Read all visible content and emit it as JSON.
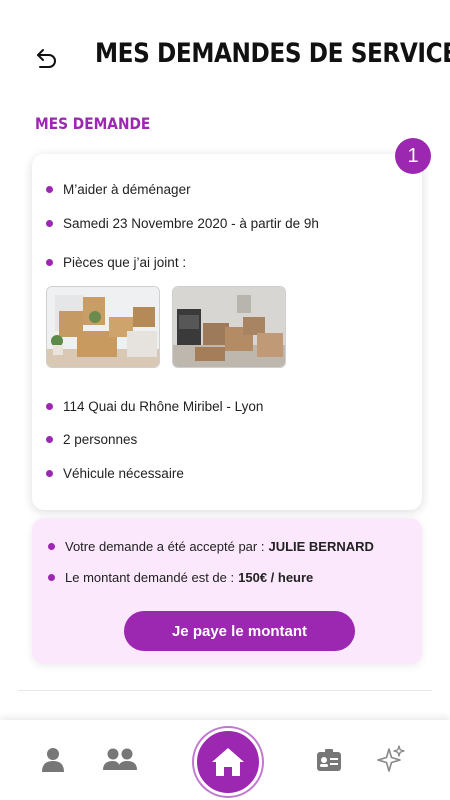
{
  "header": {
    "title": "MES DEMANDES DE SERVICE",
    "back_icon": "back-arrow-icon"
  },
  "section": {
    "title": "MES DEMANDE"
  },
  "request": {
    "count": "1",
    "service": "M’aider à déménager",
    "date": "Samedi 23 Novembre 2020 - à partir de 9h",
    "attachments_label": "Pièces que j’ai joint :",
    "address": "114 Quai du Rhône Miribel - Lyon",
    "people": "2 personnes",
    "vehicle": "Véhicule nécessaire"
  },
  "acceptance": {
    "accepted_text": "Votre demande a été accepté par :",
    "accepted_by": "JULIE BERNARD",
    "amount_text": "Le montant demandé est de :",
    "amount_value": "150€ / heure",
    "pay_button": "Je paye le montant"
  },
  "colors": {
    "accent": "#9c27b0",
    "accent_light_bg": "#fbe8fc",
    "nav_icon": "#777777"
  },
  "nav": {
    "items": [
      "user-icon",
      "group-icon",
      "home-icon",
      "id-card-icon",
      "sparkles-icon"
    ]
  }
}
